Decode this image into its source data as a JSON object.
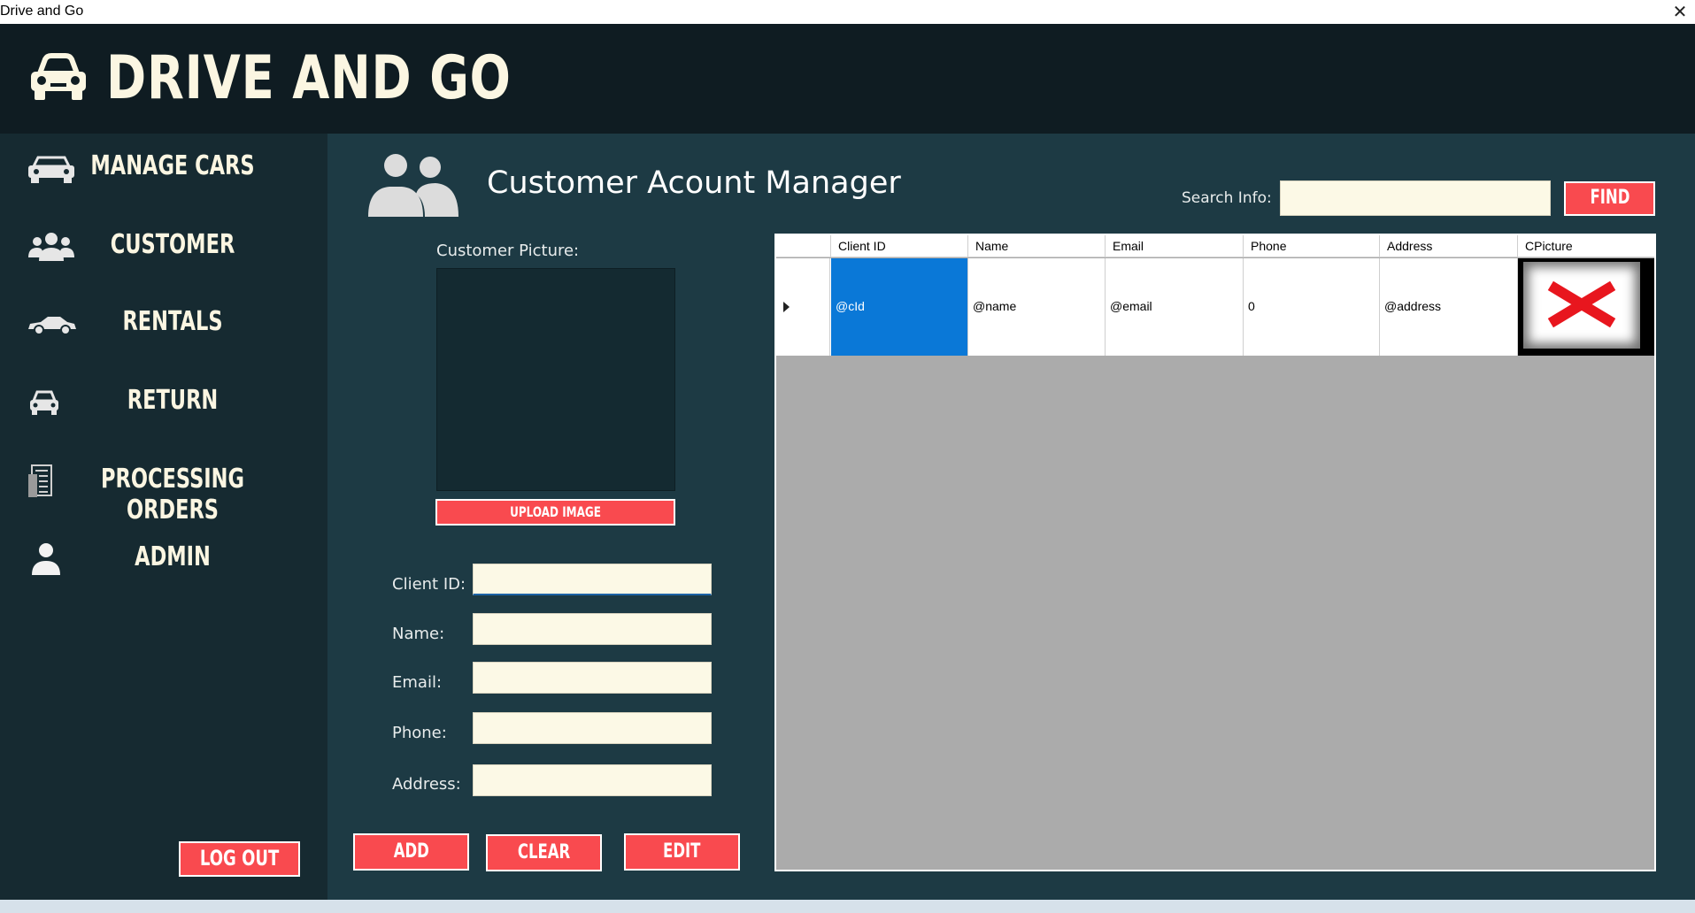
{
  "window": {
    "title": "Drive and Go",
    "close_glyph": "✕"
  },
  "header": {
    "app_title": "DRIVE AND GO",
    "logo_icon": "car-front-icon"
  },
  "sidebar": {
    "items": [
      {
        "label": "MANAGE CARS",
        "icon": "cars-icon"
      },
      {
        "label": "CUSTOMER",
        "icon": "users-icon"
      },
      {
        "label": "RENTALS",
        "icon": "sedan-icon"
      },
      {
        "label": "RETURN",
        "icon": "car-icon"
      },
      {
        "label": "PROCESSING ORDERS",
        "icon": "orders-icon"
      },
      {
        "label": "ADMIN",
        "icon": "user-icon"
      }
    ],
    "logout_label": "LOG OUT"
  },
  "main": {
    "title": "Customer Acount Manager",
    "search_label": "Search Info:",
    "search_value": "",
    "find_label": "FIND",
    "picture_label": "Customer Picture:",
    "upload_label": "UPLOAD IMAGE",
    "form": {
      "client_id_label": "Client ID:",
      "name_label": "Name:",
      "email_label": "Email:",
      "phone_label": "Phone:",
      "address_label": "Address:"
    },
    "actions": {
      "add": "ADD",
      "clear": "CLEAR",
      "edit": "EDIT"
    }
  },
  "grid": {
    "columns": [
      "Client ID",
      "Name",
      "Email",
      "Phone",
      "Address",
      "CPicture"
    ],
    "rows": [
      {
        "client_id": "@cId",
        "name": "@name",
        "email": "@email",
        "phone": "0",
        "address": "@address"
      }
    ]
  },
  "colors": {
    "accent": "#f94a4f",
    "header_bg": "#0f1c22",
    "sidebar_bg": "#162a31",
    "main_bg": "#1d3a44",
    "input_bg": "#fcf9e6",
    "selection": "#0a78d7",
    "title_text": "#fbf6e2"
  }
}
